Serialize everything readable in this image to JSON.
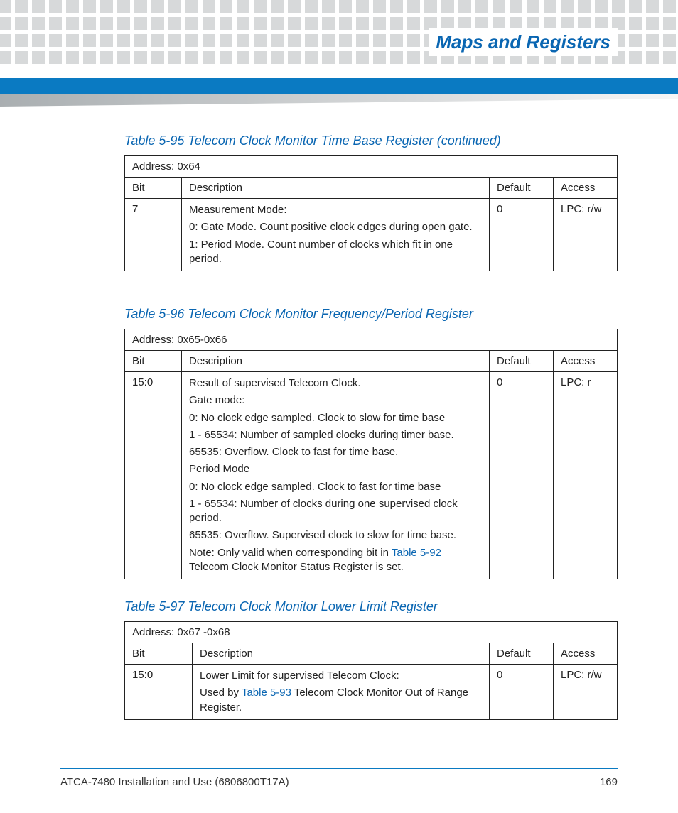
{
  "header": {
    "section_title": "Maps and Registers"
  },
  "tables": [
    {
      "caption": "Table 5-95 Telecom Clock Monitor Time Base Register (continued)",
      "address": "Address: 0x64",
      "cols": {
        "bit": "Bit",
        "desc": "Description",
        "def": "Default",
        "acc": "Access"
      },
      "rows": [
        {
          "bit": "7",
          "desc_lines": [
            "Measurement Mode:",
            "0: Gate Mode. Count positive clock edges during open gate.",
            "1: Period Mode. Count number of clocks which fit in one period."
          ],
          "def": "0",
          "acc": "LPC: r/w"
        }
      ]
    },
    {
      "caption": "Table 5-96 Telecom Clock Monitor Frequency/Period Register",
      "address": "Address: 0x65-0x66",
      "cols": {
        "bit": "Bit",
        "desc": "Description",
        "def": "Default",
        "acc": "Access"
      },
      "rows": [
        {
          "bit": "15:0",
          "desc_lines": [
            "Result of supervised Telecom Clock.",
            "Gate mode:",
            "0: No clock edge sampled. Clock to slow for time base",
            "1 - 65534: Number of sampled clocks during timer base.",
            "65535: Overflow. Clock to fast for time base.",
            "Period Mode",
            "0: No clock edge sampled. Clock to fast for time base",
            "1 - 65534: Number of clocks during one supervised clock period.",
            "65535: Overflow. Supervised clock to slow for time base."
          ],
          "note_pre": "Note: Only valid when corresponding bit in ",
          "note_link": "Table 5-92",
          "note_post": " Telecom Clock Monitor Status Register is set.",
          "def": "0",
          "acc": "LPC: r"
        }
      ]
    },
    {
      "caption": "Table 5-97 Telecom Clock Monitor Lower Limit Register",
      "address": "Address: 0x67 -0x68",
      "cols": {
        "bit": "Bit",
        "desc": "Description",
        "def": "Default",
        "acc": "Access"
      },
      "rows": [
        {
          "bit": "15:0",
          "desc_lines": [
            "Lower Limit for supervised Telecom Clock:"
          ],
          "note_pre": "Used by ",
          "note_link": "Table 5-93",
          "note_post": " Telecom Clock Monitor Out of Range Register.",
          "def": "0",
          "acc": "LPC: r/w"
        }
      ]
    }
  ],
  "footer": {
    "doc": "ATCA-7480 Installation and Use (6806800T17A)",
    "page": "169"
  }
}
